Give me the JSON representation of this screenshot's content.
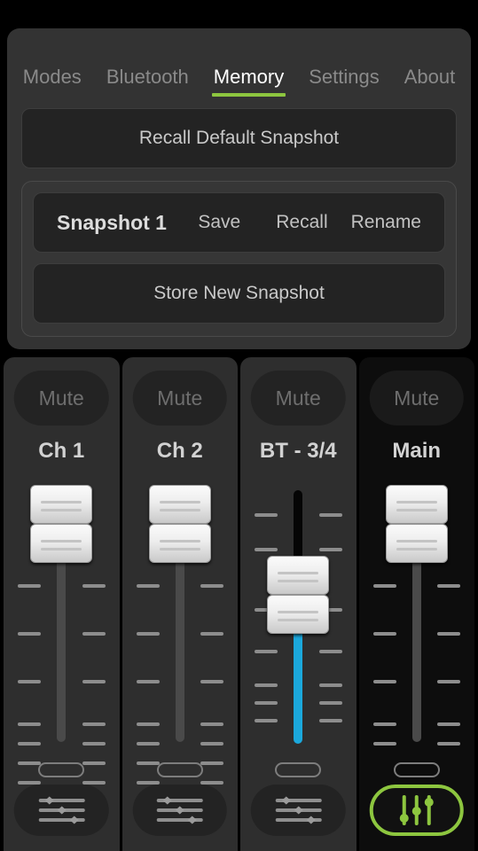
{
  "tabs": [
    {
      "label": "Modes",
      "active": false
    },
    {
      "label": "Bluetooth",
      "active": false
    },
    {
      "label": "Memory",
      "active": true
    },
    {
      "label": "Settings",
      "active": false
    },
    {
      "label": "About",
      "active": false
    }
  ],
  "memory": {
    "recall_default_label": "Recall Default Snapshot",
    "snapshot_name": "Snapshot 1",
    "save_label": "Save",
    "recall_label": "Recall",
    "rename_label": "Rename",
    "store_new_label": "Store New Snapshot"
  },
  "channels": [
    {
      "name": "Ch 1",
      "mute_label": "Mute",
      "muted": false,
      "fader_style": "plain",
      "eq_icon": "sliders-horizontal-icon",
      "eq_active": false
    },
    {
      "name": "Ch 2",
      "mute_label": "Mute",
      "muted": false,
      "fader_style": "plain",
      "eq_icon": "sliders-horizontal-icon",
      "eq_active": false
    },
    {
      "name": "BT - 3/4",
      "mute_label": "Mute",
      "muted": false,
      "fader_style": "filled",
      "eq_icon": "sliders-horizontal-icon",
      "eq_active": false
    },
    {
      "name": "Main",
      "mute_label": "Mute",
      "muted": false,
      "fader_style": "plain",
      "eq_icon": "sliders-vertical-icon",
      "eq_active": true
    }
  ],
  "colors": {
    "accent_green": "#8dc63f",
    "fader_blue": "#1ba8dc",
    "panel_bg": "#333333",
    "strip_bg": "#2e2e2e",
    "main_strip_bg": "#0d0d0d"
  }
}
